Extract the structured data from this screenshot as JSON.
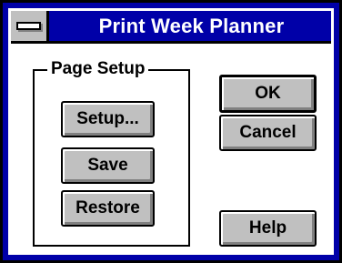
{
  "window": {
    "title": "Print Week Planner",
    "system_menu_icon": "system-menu-icon"
  },
  "page_setup": {
    "group_label": "Page Setup",
    "setup_label": "Setup...",
    "save_label": "Save",
    "restore_label": "Restore"
  },
  "actions": {
    "ok_label": "OK",
    "cancel_label": "Cancel",
    "help_label": "Help"
  },
  "colors": {
    "title_bar": "#0000a8",
    "button_face": "#c0c0c0",
    "background": "#ffffff"
  }
}
